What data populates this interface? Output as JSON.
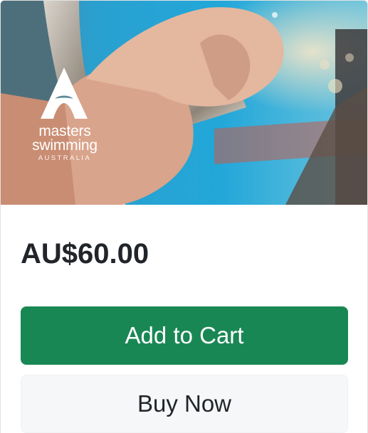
{
  "product": {
    "image_alt": "Hands gripping a pool ladder rail",
    "logo": {
      "line1": "masters",
      "line2": "swimming",
      "line3": "AUSTRALIA"
    },
    "price": "AU$60.00"
  },
  "actions": {
    "add_to_cart_label": "Add to Cart",
    "buy_now_label": "Buy Now"
  },
  "colors": {
    "primary": "#198754",
    "secondary_bg": "#f6f7f9",
    "text": "#212529",
    "pool_blue": "#2ba8d6"
  }
}
